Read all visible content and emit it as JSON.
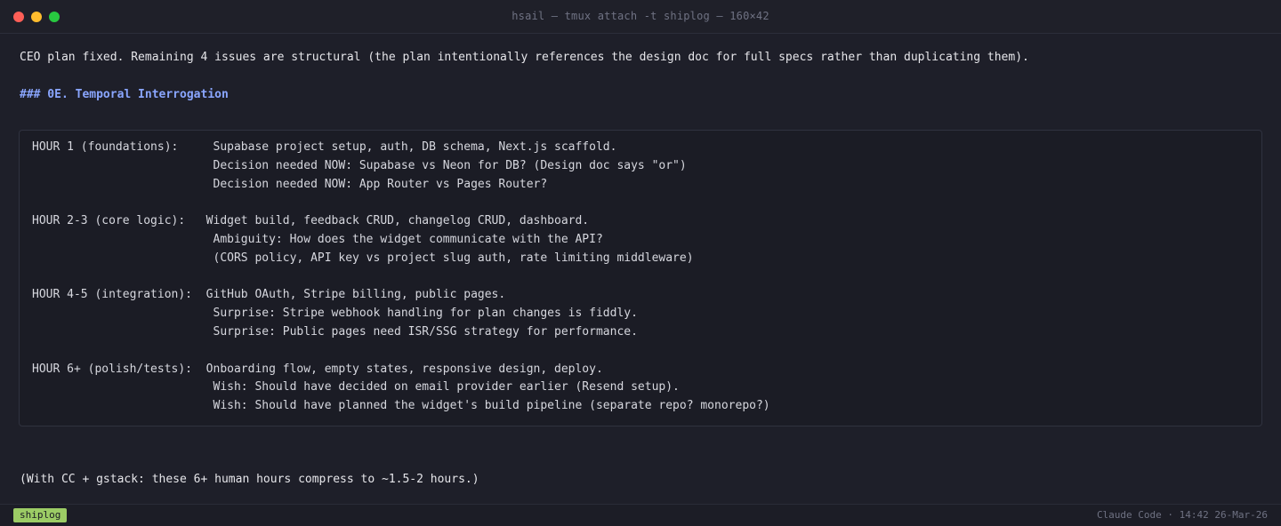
{
  "window": {
    "title": "hsail — tmux attach -t shiplog — 160×42"
  },
  "message": {
    "intro": "CEO plan fixed. Remaining 4 issues are structural (the plan intentionally references the design doc for full specs rather than duplicating them).",
    "heading": "### 0E. Temporal Interrogation",
    "code_block": "HOUR 1 (foundations):     Supabase project setup, auth, DB schema, Next.js scaffold.\n                          Decision needed NOW: Supabase vs Neon for DB? (Design doc says \"or\")\n                          Decision needed NOW: App Router vs Pages Router?\n\nHOUR 2-3 (core logic):   Widget build, feedback CRUD, changelog CRUD, dashboard.\n                          Ambiguity: How does the widget communicate with the API?\n                          (CORS policy, API key vs project slug auth, rate limiting middleware)\n\nHOUR 4-5 (integration):  GitHub OAuth, Stripe billing, public pages.\n                          Surprise: Stripe webhook handling for plan changes is fiddly.\n                          Surprise: Public pages need ISR/SSG strategy for performance.\n\nHOUR 6+ (polish/tests):  Onboarding flow, empty states, responsive design, deploy.\n                          Wish: Should have decided on email provider earlier (Resend setup).\n                          Wish: Should have planned the widget's build pipeline (separate repo? monorepo?)",
    "footer": "(With CC + gstack: these 6+ human hours compress to ~1.5-2 hours.)"
  },
  "statusbar": {
    "session": "shiplog",
    "right_text": "Claude Code · 14:42 26-Mar-26"
  },
  "colors": {
    "background": "#1e1f29",
    "heading": "#8aa6ff",
    "session_badge": "#9ccc65",
    "traffic_close": "#fe5f57",
    "traffic_minimize": "#febc2e",
    "traffic_zoom": "#28c840"
  }
}
